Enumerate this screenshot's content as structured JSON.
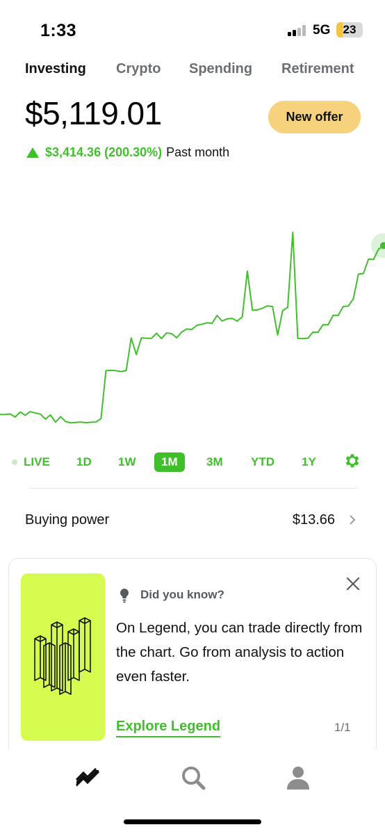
{
  "status_bar": {
    "time": "1:33",
    "network": "5G",
    "battery": "23",
    "battery_level": 0.23
  },
  "tabs": [
    {
      "label": "Investing",
      "active": true
    },
    {
      "label": "Crypto",
      "active": false
    },
    {
      "label": "Spending",
      "active": false
    },
    {
      "label": "Retirement",
      "active": false
    }
  ],
  "portfolio": {
    "balance": "$5,119.01",
    "change": "$3,414.36 (200.30%)",
    "period": "Past month",
    "offer_label": "New offer"
  },
  "colors": {
    "accent_green": "#3fbf2a",
    "offer_yellow": "#f7d27c",
    "legend_lime": "#d6fb4f"
  },
  "chart_data": {
    "type": "line",
    "title": "",
    "xlabel": "",
    "ylabel": "",
    "grid": false,
    "ylim": [
      0,
      100
    ],
    "series": [
      {
        "values": [
          9.2,
          9.2,
          9.5,
          8.0,
          10.4,
          8.8,
          10.6,
          9.9,
          9.4,
          7.0,
          9.0,
          5.5,
          8.2,
          5.8,
          5.2,
          5.4,
          5.6,
          5.3,
          5.5,
          5.6,
          7.2,
          30.2,
          30.4,
          30.2,
          29.8,
          30.3,
          45.9,
          38.0,
          45.9,
          45.8,
          45.7,
          48.2,
          45.6,
          48.3,
          48.0,
          46.0,
          48.8,
          50.2,
          50.0,
          52.0,
          52.5,
          53.2,
          52.9,
          56.7,
          54.0,
          55.1,
          55.3,
          54.0,
          56.0,
          78.0,
          59.2,
          59.4,
          60.2,
          61.3,
          61.0,
          47.3,
          59.0,
          60.6,
          96.6,
          45.7,
          45.6,
          45.8,
          48.7,
          48.6,
          52.3,
          52.2,
          56.8,
          56.7,
          61.0,
          61.2,
          64.7,
          76.5,
          76.8,
          83.7,
          83.6,
          88.5,
          90.2
        ]
      }
    ],
    "current_dot_value": 90.2
  },
  "time_ranges": {
    "items": [
      {
        "label": "LIVE",
        "active": false
      },
      {
        "label": "1D",
        "active": false
      },
      {
        "label": "1W",
        "active": false
      },
      {
        "label": "1M",
        "active": true
      },
      {
        "label": "3M",
        "active": false
      },
      {
        "label": "YTD",
        "active": false
      },
      {
        "label": "1Y",
        "active": false
      }
    ],
    "settings_icon": "gear-icon"
  },
  "buying_power": {
    "label": "Buying power",
    "value": "$13.66"
  },
  "promo": {
    "eyebrow": "Did you know?",
    "body": "On Legend, you can trade directly from the chart. Go from analysis to action even faster.",
    "cta": "Explore Legend",
    "pager": "1/1",
    "icons": [
      "lightbulb-icon",
      "close-icon",
      "legend-bars-illustration"
    ]
  },
  "bottom_nav": {
    "items": [
      {
        "icon": "investing-chart-icon",
        "active": true
      },
      {
        "icon": "search-icon",
        "active": false
      },
      {
        "icon": "account-icon",
        "active": false
      }
    ]
  }
}
